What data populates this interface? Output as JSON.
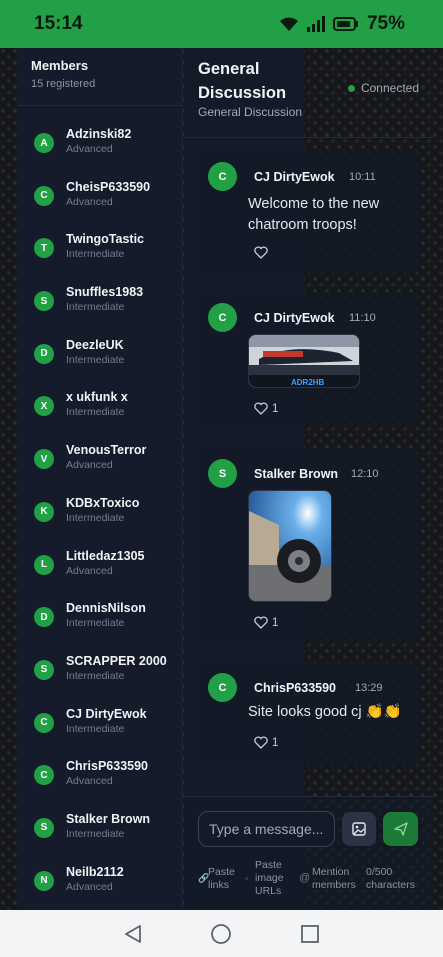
{
  "status_bar": {
    "time": "15:14",
    "battery": "75%"
  },
  "sidebar": {
    "title": "Members",
    "count": "15 registered",
    "members": [
      {
        "initial": "A",
        "name": "Adzinski82",
        "level": "Advanced"
      },
      {
        "initial": "C",
        "name": "CheisP633590",
        "level": "Advanced"
      },
      {
        "initial": "T",
        "name": "TwingoTastic",
        "level": "Intermediate"
      },
      {
        "initial": "S",
        "name": "Snuffles1983",
        "level": "Intermediate"
      },
      {
        "initial": "D",
        "name": "DeezleUK",
        "level": "Intermediate"
      },
      {
        "initial": "X",
        "name": "x ukfunk x",
        "level": "Intermediate"
      },
      {
        "initial": "V",
        "name": "VenousTerror",
        "level": "Advanced"
      },
      {
        "initial": "K",
        "name": "KDBxToxico",
        "level": "Intermediate"
      },
      {
        "initial": "L",
        "name": "Littledaz1305",
        "level": "Advanced"
      },
      {
        "initial": "D",
        "name": "DennisNilson",
        "level": "Intermediate"
      },
      {
        "initial": "S",
        "name": "SCRAPPER 2000",
        "level": "Intermediate"
      },
      {
        "initial": "C",
        "name": "CJ DirtyEwok",
        "level": "Intermediate"
      },
      {
        "initial": "C",
        "name": "ChrisP633590",
        "level": "Advanced"
      },
      {
        "initial": "S",
        "name": "Stalker Brown",
        "level": "Intermediate"
      },
      {
        "initial": "N",
        "name": "Neilb2112",
        "level": "Advanced"
      }
    ]
  },
  "chat": {
    "title": "General Discussion",
    "subtitle": "General Discussion",
    "connection_status": "Connected",
    "messages": [
      {
        "initial": "C",
        "author": "CJ DirtyEwok",
        "time": "10:11",
        "text": "Welcome to the new chatroom troops!",
        "likes": ""
      },
      {
        "initial": "C",
        "author": "CJ DirtyEwok",
        "time": "11:10",
        "image": "race-car-photo",
        "image_caption": "ADR2HB",
        "likes": "1"
      },
      {
        "initial": "S",
        "author": "Stalker Brown",
        "time": "12:10",
        "image": "wheel-photo",
        "likes": "1"
      },
      {
        "initial": "C",
        "author": "ChrisP633590",
        "time": "13:29",
        "text": "Site looks good cj 👏👏",
        "likes": "1"
      }
    ]
  },
  "composer": {
    "placeholder": "Type a message...",
    "hints": {
      "paste_links": "Paste links",
      "paste_images": "Paste image URLs",
      "mention": "Mention members",
      "char_count": "0/500 characters"
    }
  },
  "colors": {
    "accent": "#22a045",
    "panel": "#151b2a",
    "status_bar": "#22a045"
  },
  "icons": [
    "wifi-icon",
    "signal-icon",
    "battery-icon",
    "heart-icon",
    "image-icon",
    "send-icon",
    "back-icon",
    "home-icon",
    "recents-icon"
  ]
}
